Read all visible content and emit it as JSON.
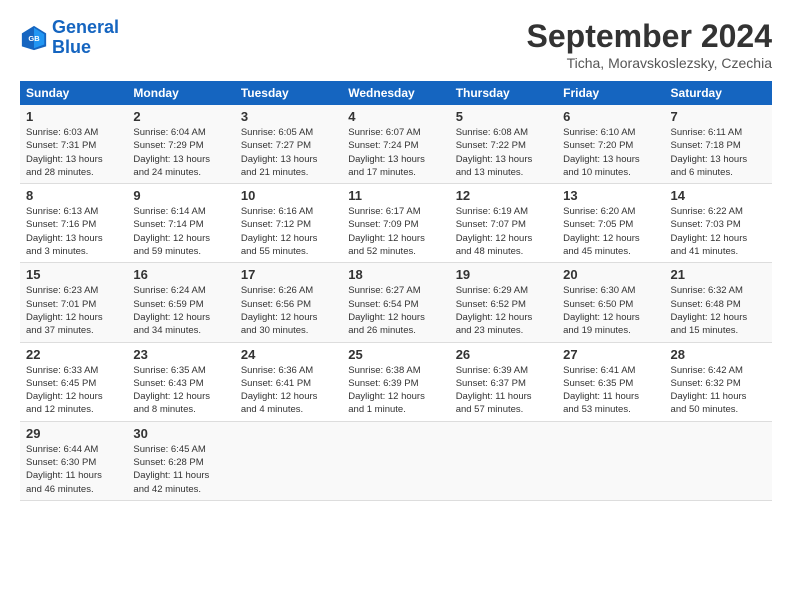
{
  "logo": {
    "line1": "General",
    "line2": "Blue"
  },
  "title": "September 2024",
  "subtitle": "Ticha, Moravskoslezsky, Czechia",
  "days_header": [
    "Sunday",
    "Monday",
    "Tuesday",
    "Wednesday",
    "Thursday",
    "Friday",
    "Saturday"
  ],
  "weeks": [
    [
      {
        "num": "1",
        "info": "Sunrise: 6:03 AM\nSunset: 7:31 PM\nDaylight: 13 hours\nand 28 minutes."
      },
      {
        "num": "2",
        "info": "Sunrise: 6:04 AM\nSunset: 7:29 PM\nDaylight: 13 hours\nand 24 minutes."
      },
      {
        "num": "3",
        "info": "Sunrise: 6:05 AM\nSunset: 7:27 PM\nDaylight: 13 hours\nand 21 minutes."
      },
      {
        "num": "4",
        "info": "Sunrise: 6:07 AM\nSunset: 7:24 PM\nDaylight: 13 hours\nand 17 minutes."
      },
      {
        "num": "5",
        "info": "Sunrise: 6:08 AM\nSunset: 7:22 PM\nDaylight: 13 hours\nand 13 minutes."
      },
      {
        "num": "6",
        "info": "Sunrise: 6:10 AM\nSunset: 7:20 PM\nDaylight: 13 hours\nand 10 minutes."
      },
      {
        "num": "7",
        "info": "Sunrise: 6:11 AM\nSunset: 7:18 PM\nDaylight: 13 hours\nand 6 minutes."
      }
    ],
    [
      {
        "num": "8",
        "info": "Sunrise: 6:13 AM\nSunset: 7:16 PM\nDaylight: 13 hours\nand 3 minutes."
      },
      {
        "num": "9",
        "info": "Sunrise: 6:14 AM\nSunset: 7:14 PM\nDaylight: 12 hours\nand 59 minutes."
      },
      {
        "num": "10",
        "info": "Sunrise: 6:16 AM\nSunset: 7:12 PM\nDaylight: 12 hours\nand 55 minutes."
      },
      {
        "num": "11",
        "info": "Sunrise: 6:17 AM\nSunset: 7:09 PM\nDaylight: 12 hours\nand 52 minutes."
      },
      {
        "num": "12",
        "info": "Sunrise: 6:19 AM\nSunset: 7:07 PM\nDaylight: 12 hours\nand 48 minutes."
      },
      {
        "num": "13",
        "info": "Sunrise: 6:20 AM\nSunset: 7:05 PM\nDaylight: 12 hours\nand 45 minutes."
      },
      {
        "num": "14",
        "info": "Sunrise: 6:22 AM\nSunset: 7:03 PM\nDaylight: 12 hours\nand 41 minutes."
      }
    ],
    [
      {
        "num": "15",
        "info": "Sunrise: 6:23 AM\nSunset: 7:01 PM\nDaylight: 12 hours\nand 37 minutes."
      },
      {
        "num": "16",
        "info": "Sunrise: 6:24 AM\nSunset: 6:59 PM\nDaylight: 12 hours\nand 34 minutes."
      },
      {
        "num": "17",
        "info": "Sunrise: 6:26 AM\nSunset: 6:56 PM\nDaylight: 12 hours\nand 30 minutes."
      },
      {
        "num": "18",
        "info": "Sunrise: 6:27 AM\nSunset: 6:54 PM\nDaylight: 12 hours\nand 26 minutes."
      },
      {
        "num": "19",
        "info": "Sunrise: 6:29 AM\nSunset: 6:52 PM\nDaylight: 12 hours\nand 23 minutes."
      },
      {
        "num": "20",
        "info": "Sunrise: 6:30 AM\nSunset: 6:50 PM\nDaylight: 12 hours\nand 19 minutes."
      },
      {
        "num": "21",
        "info": "Sunrise: 6:32 AM\nSunset: 6:48 PM\nDaylight: 12 hours\nand 15 minutes."
      }
    ],
    [
      {
        "num": "22",
        "info": "Sunrise: 6:33 AM\nSunset: 6:45 PM\nDaylight: 12 hours\nand 12 minutes."
      },
      {
        "num": "23",
        "info": "Sunrise: 6:35 AM\nSunset: 6:43 PM\nDaylight: 12 hours\nand 8 minutes."
      },
      {
        "num": "24",
        "info": "Sunrise: 6:36 AM\nSunset: 6:41 PM\nDaylight: 12 hours\nand 4 minutes."
      },
      {
        "num": "25",
        "info": "Sunrise: 6:38 AM\nSunset: 6:39 PM\nDaylight: 12 hours\nand 1 minute."
      },
      {
        "num": "26",
        "info": "Sunrise: 6:39 AM\nSunset: 6:37 PM\nDaylight: 11 hours\nand 57 minutes."
      },
      {
        "num": "27",
        "info": "Sunrise: 6:41 AM\nSunset: 6:35 PM\nDaylight: 11 hours\nand 53 minutes."
      },
      {
        "num": "28",
        "info": "Sunrise: 6:42 AM\nSunset: 6:32 PM\nDaylight: 11 hours\nand 50 minutes."
      }
    ],
    [
      {
        "num": "29",
        "info": "Sunrise: 6:44 AM\nSunset: 6:30 PM\nDaylight: 11 hours\nand 46 minutes."
      },
      {
        "num": "30",
        "info": "Sunrise: 6:45 AM\nSunset: 6:28 PM\nDaylight: 11 hours\nand 42 minutes."
      },
      {
        "num": "",
        "info": ""
      },
      {
        "num": "",
        "info": ""
      },
      {
        "num": "",
        "info": ""
      },
      {
        "num": "",
        "info": ""
      },
      {
        "num": "",
        "info": ""
      }
    ]
  ]
}
